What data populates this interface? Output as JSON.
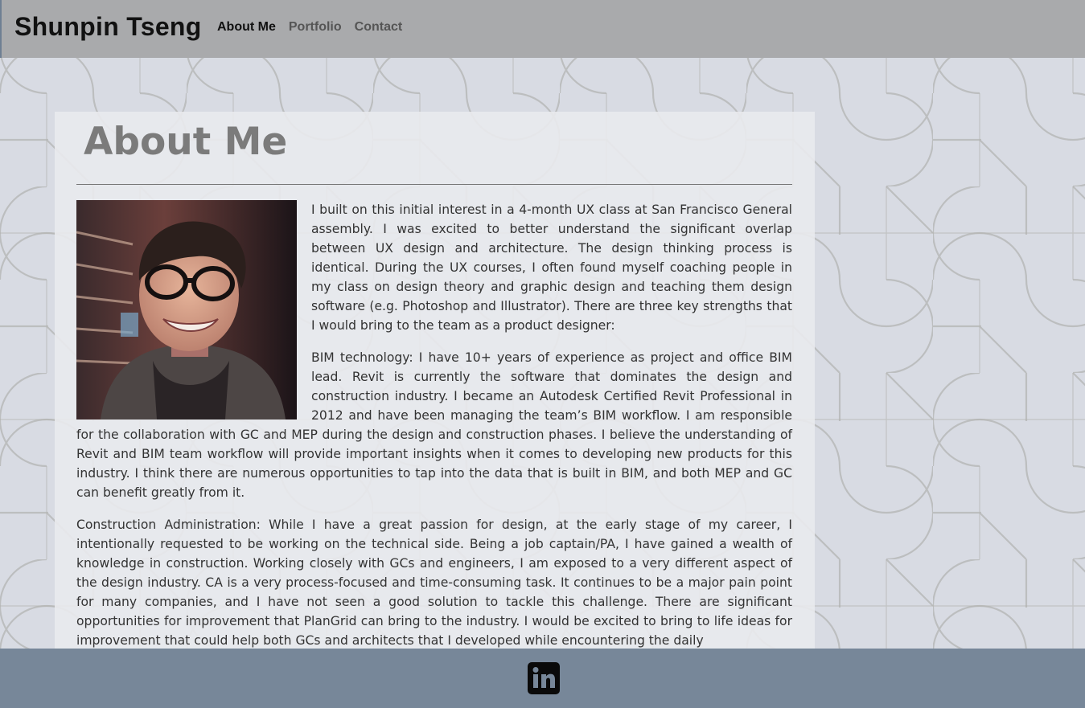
{
  "header": {
    "site_title": "Shunpin Tseng",
    "nav": [
      {
        "label": "About Me",
        "active": true
      },
      {
        "label": "Portfolio",
        "active": false
      },
      {
        "label": "Contact",
        "active": false
      }
    ]
  },
  "main": {
    "title": "About Me",
    "portrait_icon": "portrait-photo",
    "paragraphs": [
      "I built on this initial interest in a 4-month UX class at San Francisco General assembly. I was excited to better understand the significant overlap between UX design and architecture. The design thinking process is identical. During the UX courses, I often found myself coaching people in my class on design theory and graphic design and teaching them design software (e.g. Photoshop and Illustrator). There are three key strengths that I would bring to the team as a product designer:",
      "BIM technology: I have 10+ years of experience as project and office BIM lead. Revit is currently the software that dominates the design and construction industry. I became an Autodesk Certified Revit Professional in 2012 and have been managing the team’s BIM workflow. I am responsible for the collaboration with GC and MEP during the design and construction phases. I believe the understanding of Revit and BIM team workflow will provide important insights when it comes to developing new products for this industry. I think there are numerous opportunities to tap into the data that is built in BIM, and both MEP and GC can benefit greatly from it.",
      "Construction Administration: While I have a great passion for design, at the early stage of my career, I intentionally requested to be working on the technical side. Being a job captain/PA, I have gained a wealth of knowledge in construction. Working closely with GCs and engineers, I am exposed to a very different aspect of the design industry. CA is a very process-focused and time-consuming task. It continues to be a major pain point for many companies, and I have not seen a good solution to tackle this challenge. There are significant opportunities for improvement that PlanGrid can bring to the industry. I would be excited to bring to life ideas for improvement that could help both GCs and architects that I developed while encountering the daily"
    ]
  },
  "footer": {
    "social_icon": "linkedin-icon"
  },
  "colors": {
    "topbar": "#a9aaac",
    "footer": "#778799",
    "background": "#d8dbe3",
    "title_gray": "#7b7b7b"
  }
}
